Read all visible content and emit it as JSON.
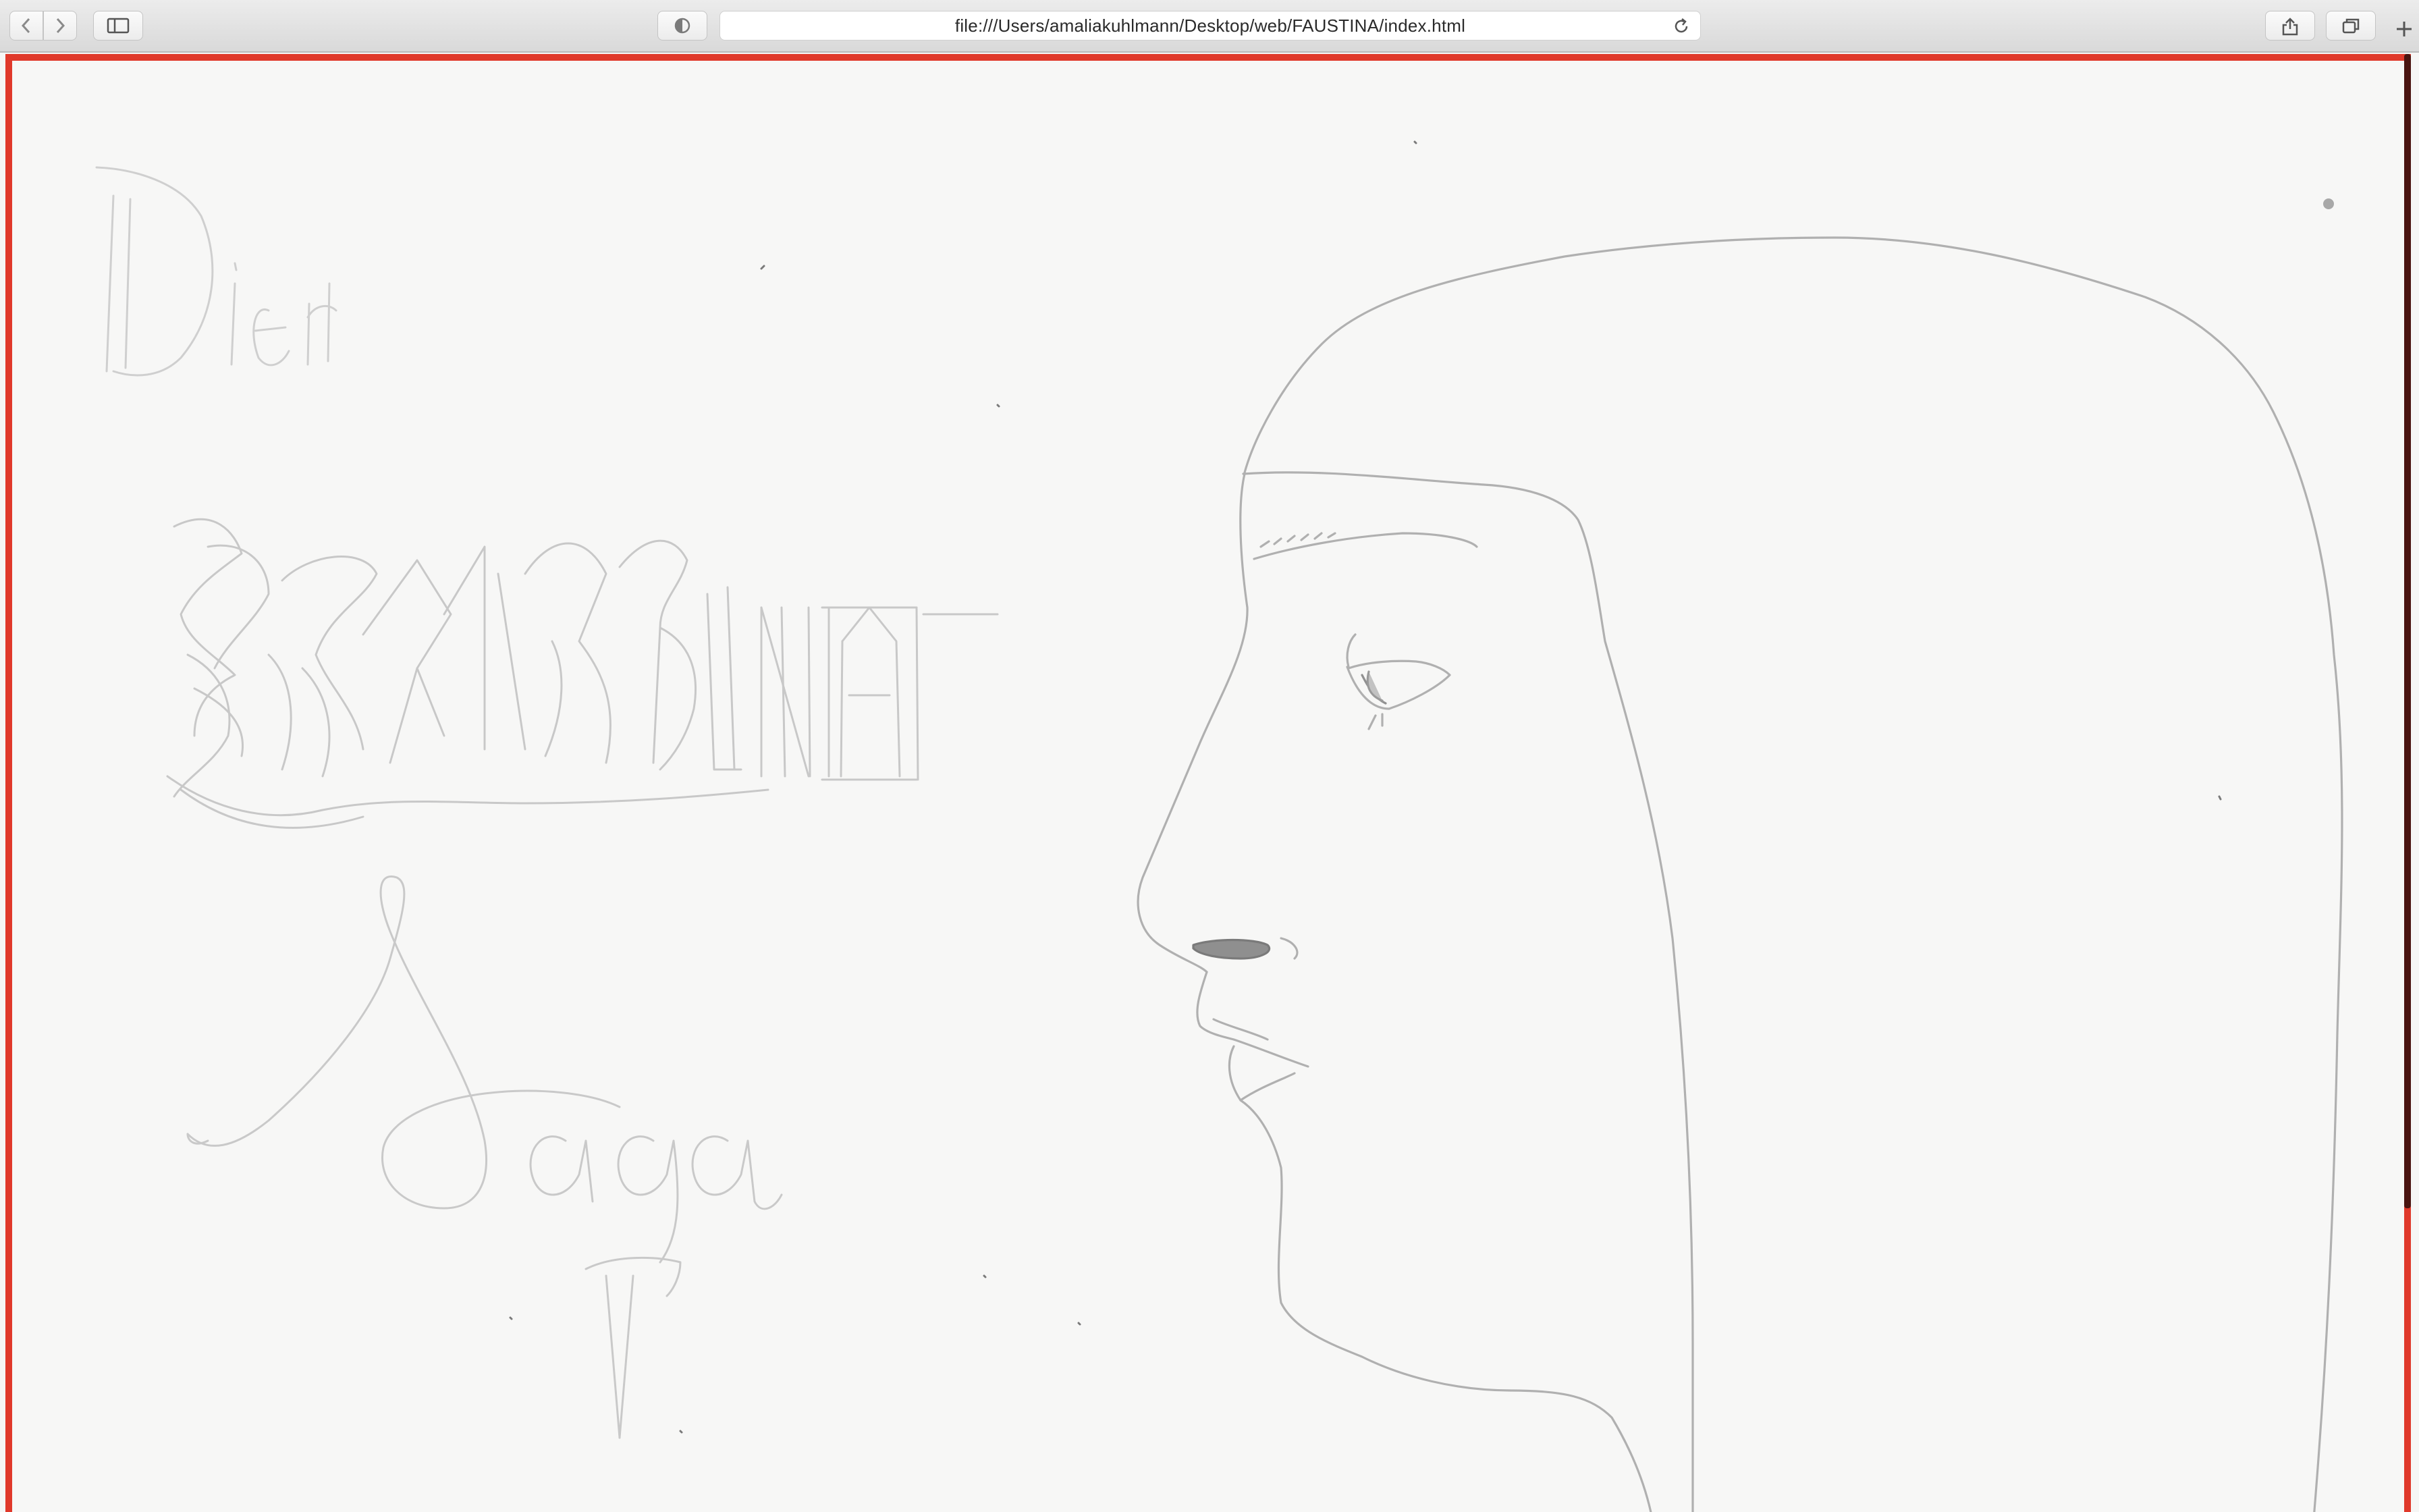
{
  "browser": {
    "address_bar": {
      "url": "file:///Users/amaliakuhlmann/Desktop/web/FAUSTINA/index.html"
    },
    "buttons": {
      "back": "chevron-left-icon",
      "forward": "chevron-right-icon",
      "sidebar": "sidebar-icon",
      "privacy": "shield-icon",
      "reload": "reload-icon",
      "share": "share-icon",
      "tabs": "tabs-overview-icon",
      "new_tab": "plus-icon"
    }
  },
  "colors": {
    "frame_border": "#e0392b",
    "paper": "#f7f7f6",
    "pencil": "#b5b5b5",
    "scrollbar": "#4a1410"
  },
  "page": {
    "artwork": {
      "description_icon": "pencil-drawing"
    }
  }
}
